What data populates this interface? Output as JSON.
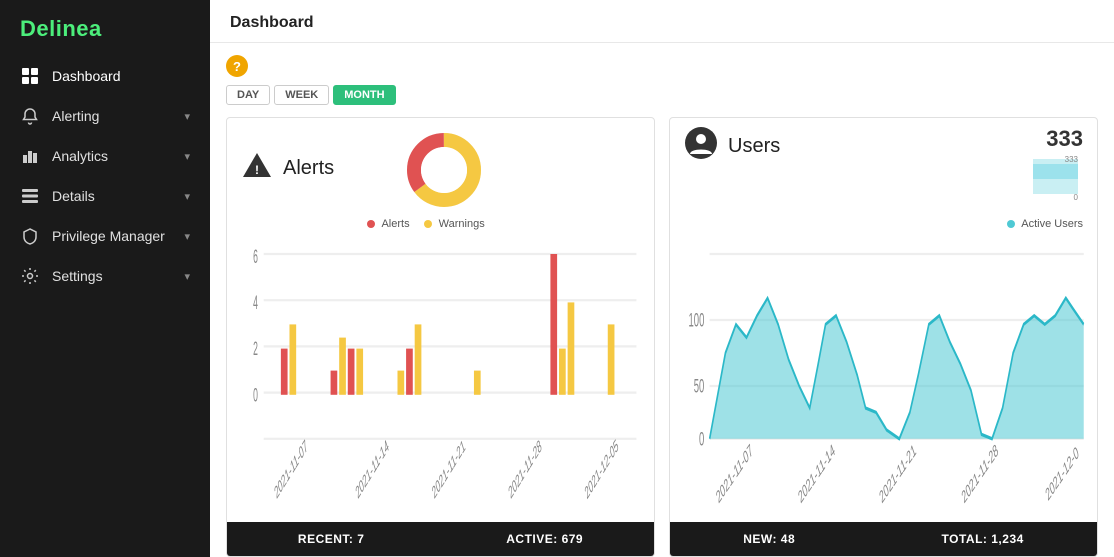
{
  "brand": "Delinea",
  "sidebar": {
    "items": [
      {
        "id": "dashboard",
        "label": "Dashboard",
        "icon": "grid",
        "active": true,
        "hasChevron": false
      },
      {
        "id": "alerting",
        "label": "Alerting",
        "icon": "bell",
        "active": false,
        "hasChevron": true
      },
      {
        "id": "analytics",
        "label": "Analytics",
        "icon": "bar-chart",
        "active": false,
        "hasChevron": true
      },
      {
        "id": "details",
        "label": "Details",
        "icon": "list",
        "active": false,
        "hasChevron": true
      },
      {
        "id": "privilege-manager",
        "label": "Privilege Manager",
        "icon": "shield",
        "active": false,
        "hasChevron": true
      },
      {
        "id": "settings",
        "label": "Settings",
        "icon": "gear",
        "active": false,
        "hasChevron": true
      }
    ]
  },
  "page": {
    "title": "Dashboard"
  },
  "timeRange": {
    "buttons": [
      "DAY",
      "WEEK",
      "MONTH"
    ],
    "active": "MONTH"
  },
  "alertsPanel": {
    "title": "Alerts",
    "footer": {
      "recent_label": "RECENT: 7",
      "active_label": "ACTIVE: 679"
    },
    "legend": {
      "alerts_label": "Alerts",
      "warnings_label": "Warnings"
    }
  },
  "usersPanel": {
    "title": "Users",
    "count": "333",
    "zero_label": "0",
    "area_legend": "Active Users",
    "footer": {
      "new_label": "NEW: 48",
      "total_label": "TOTAL: 1,234"
    }
  }
}
